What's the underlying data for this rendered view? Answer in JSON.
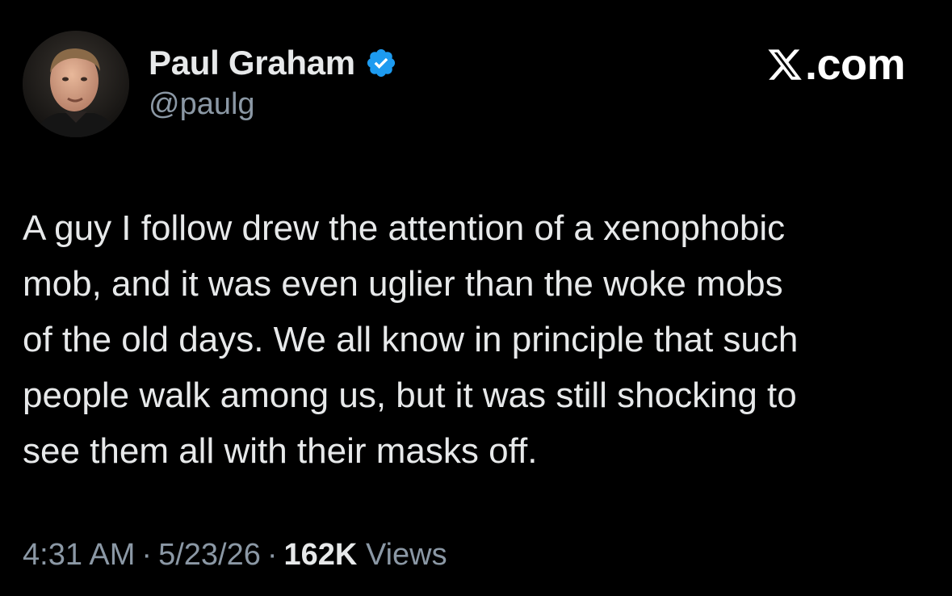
{
  "author": {
    "display_name": "Paul Graham",
    "handle": "@paulg",
    "verified": true,
    "verified_color": "#1d9bf0"
  },
  "brand": {
    "label": ".com",
    "icon": "x-logo-icon"
  },
  "tweet": {
    "lines": [
      "A guy I follow drew the attention of a xenophobic",
      "mob, and it was even uglier than the woke mobs",
      "of the old days. We all know in principle that such",
      "people walk among us, but it was still shocking to",
      "see them all with their masks off."
    ]
  },
  "meta": {
    "time": "4:31 AM",
    "separator": "·",
    "date": "5/23/26",
    "views_count": "162K",
    "views_label": "Views"
  },
  "colors": {
    "background": "#000000",
    "text_primary": "#e7e9ea",
    "text_secondary": "#8b98a5",
    "accent": "#1d9bf0"
  }
}
